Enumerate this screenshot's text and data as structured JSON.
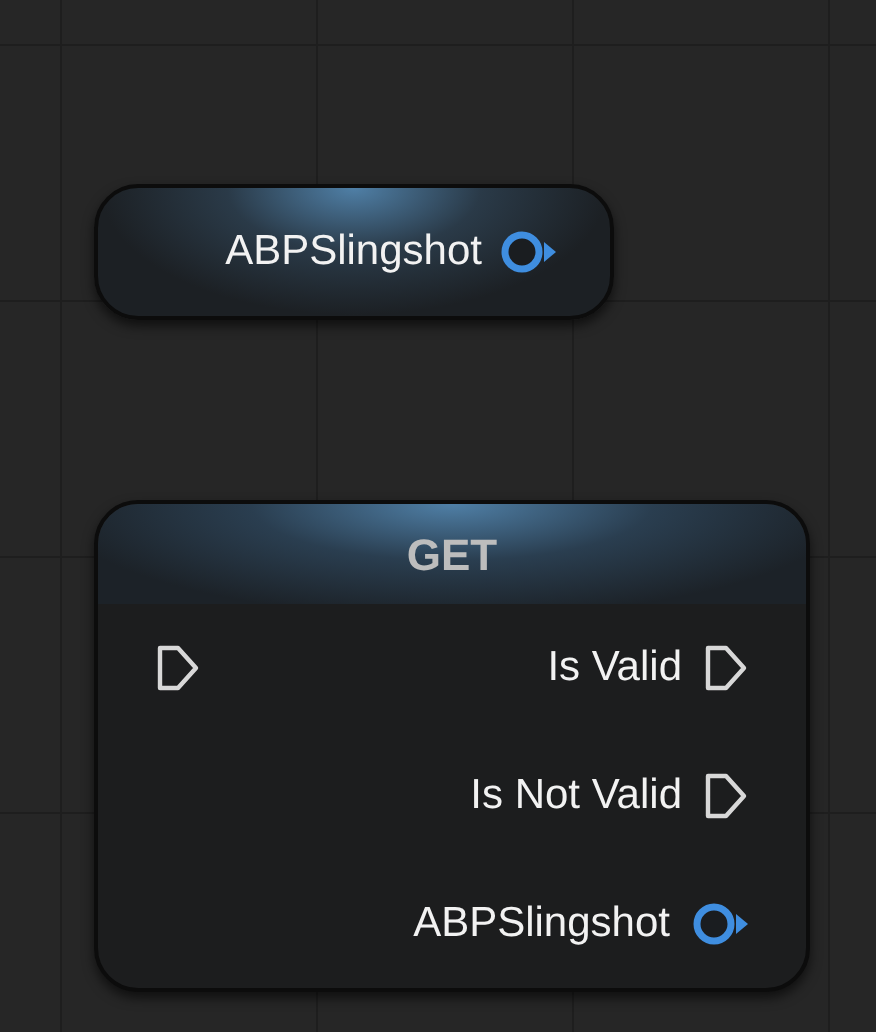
{
  "nodes": [
    {
      "kind": "variable",
      "outputs": [
        {
          "kind": "object",
          "label": "ABPSlingshot"
        }
      ]
    },
    {
      "kind": "function",
      "title": "GET",
      "inputs": [
        {
          "kind": "exec"
        }
      ],
      "outputs": [
        {
          "kind": "exec",
          "label": "Is Valid"
        },
        {
          "kind": "exec",
          "label": "Is Not Valid"
        },
        {
          "kind": "object",
          "label": "ABPSlingshot"
        }
      ]
    }
  ]
}
